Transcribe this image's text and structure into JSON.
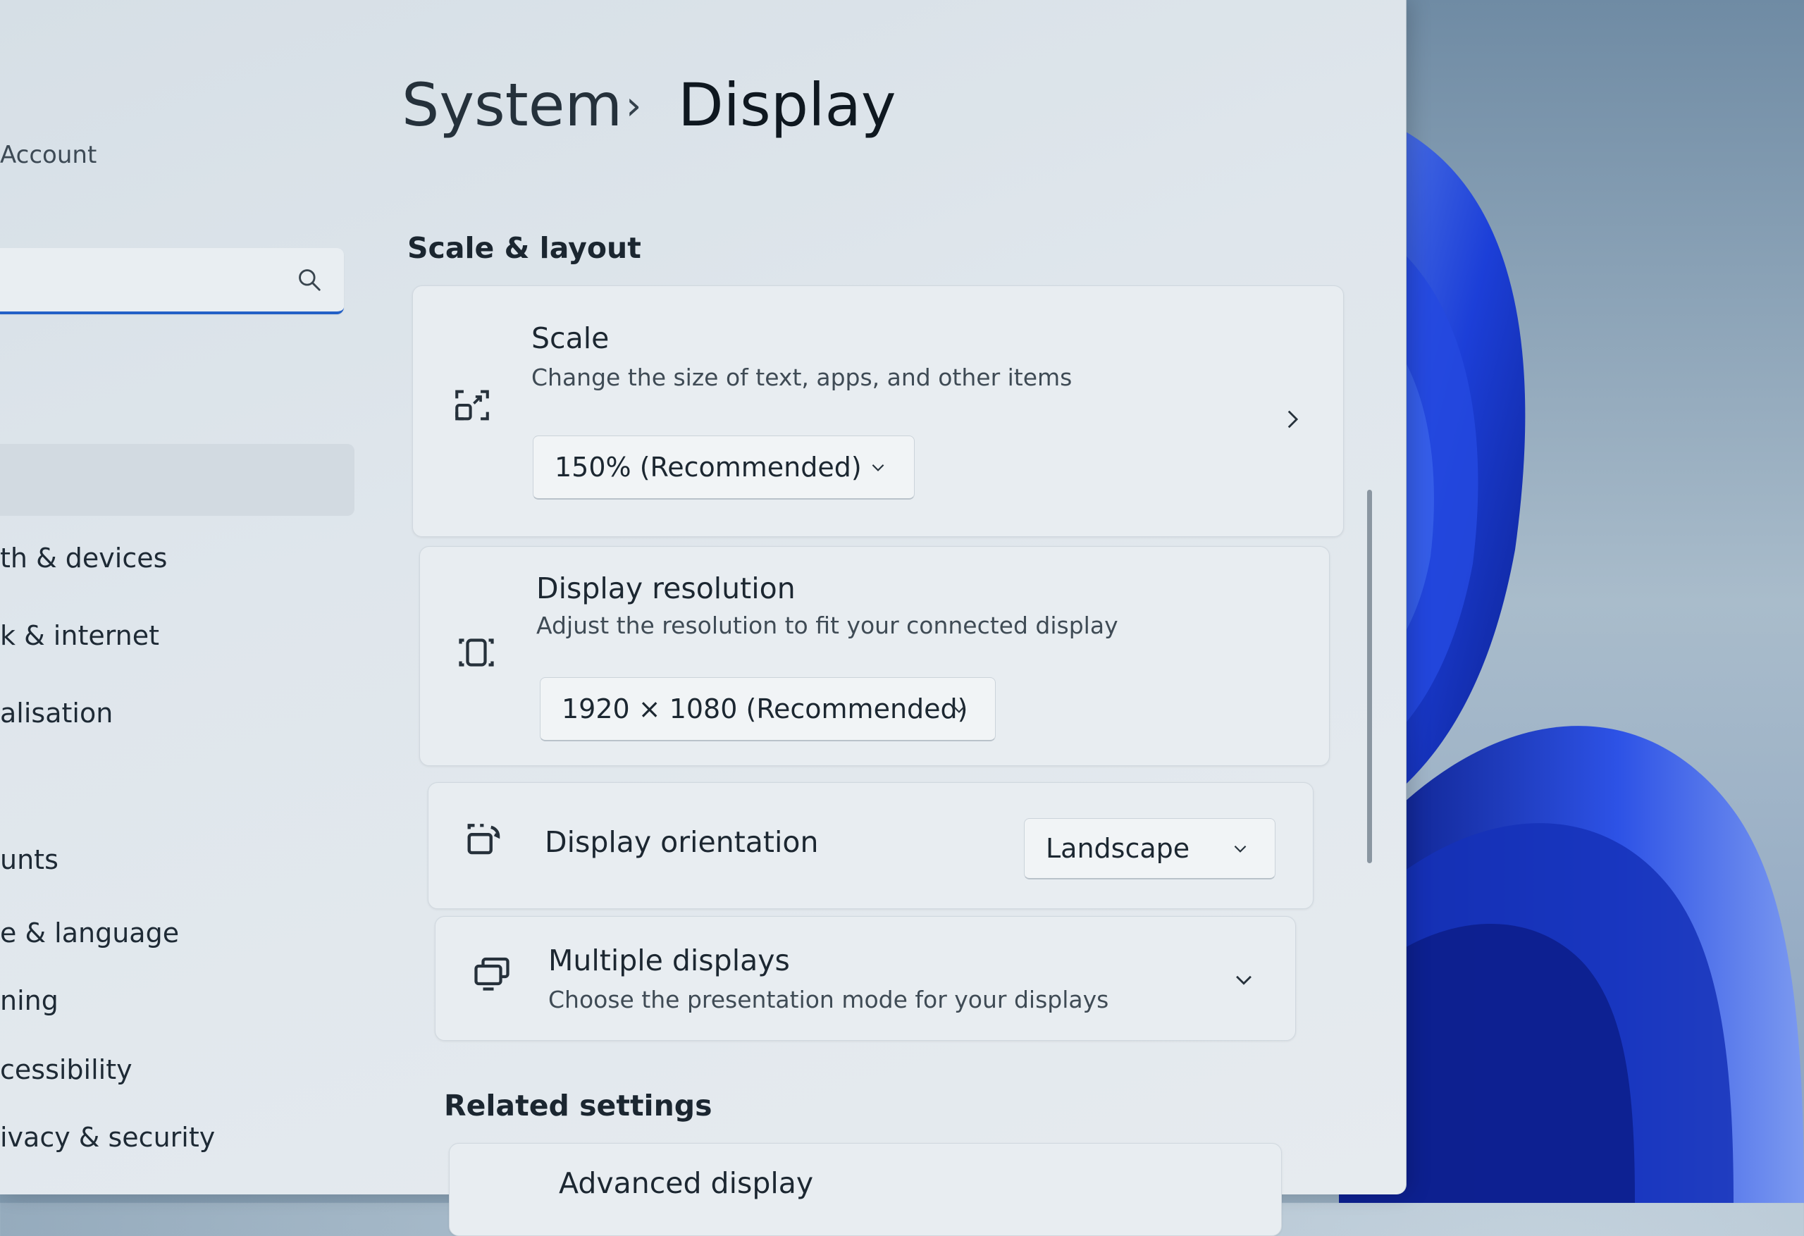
{
  "app": {
    "breadcrumb_parent": "System",
    "breadcrumb_separator": "›",
    "page_title": "Display"
  },
  "sidebar": {
    "account_label": "Account",
    "search_placeholder": "",
    "items": [
      {
        "label": "th & devices"
      },
      {
        "label": "k & internet"
      },
      {
        "label": "alisation"
      },
      {
        "label": "unts"
      },
      {
        "label": "e & language"
      },
      {
        "label": "ning"
      },
      {
        "label": "cessibility"
      },
      {
        "label": "ivacy & security"
      }
    ]
  },
  "main": {
    "section_scale_layout": "Scale & layout",
    "scale": {
      "title": "Scale",
      "subtitle": "Change the size of text, apps, and other items",
      "value": "150% (Recommended)"
    },
    "resolution": {
      "title": "Display resolution",
      "subtitle": "Adjust the resolution to fit your connected display",
      "value": "1920 × 1080 (Recommended)"
    },
    "orientation": {
      "title": "Display orientation",
      "value": "Landscape"
    },
    "multiple": {
      "title": "Multiple displays",
      "subtitle": "Choose the presentation mode for your displays"
    },
    "section_related": "Related settings",
    "advanced": {
      "title": "Advanced display"
    }
  },
  "icons": {
    "search": "search-icon",
    "scale": "scale-icon",
    "resolution": "resolution-icon",
    "orientation": "rotate-display-icon",
    "multiple": "multiple-displays-icon",
    "chevron_right": "chevron-right-icon",
    "chevron_down": "chevron-down-icon"
  },
  "colors": {
    "accent": "#2360c6",
    "wallpaper_blue": "#1a3fd6"
  }
}
